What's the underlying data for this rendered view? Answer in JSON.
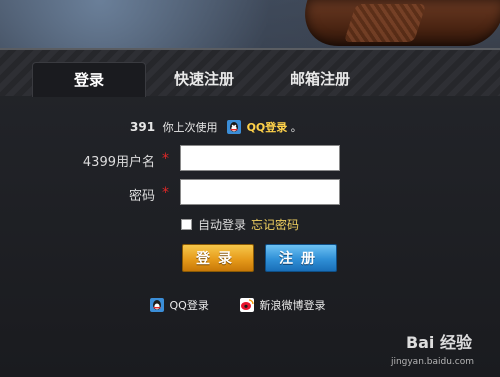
{
  "tabs": [
    {
      "label": "登录",
      "active": true
    },
    {
      "label": "快速注册",
      "active": false
    },
    {
      "label": "邮箱注册",
      "active": false
    }
  ],
  "hint": {
    "logo_text": "391",
    "prefix": "你上次使用",
    "method": "QQ登录",
    "suffix": "。"
  },
  "form": {
    "username_label": "4399用户名",
    "password_label": "密码",
    "required_mark": "*",
    "username_value": "",
    "password_value": "",
    "remember_label": "自动登录",
    "forgot_label": "忘记密码"
  },
  "buttons": {
    "login": "登录",
    "register": "注册"
  },
  "social": {
    "qq": "QQ登录",
    "weibo": "新浪微博登录"
  },
  "watermark": {
    "brand": "Bai 经验",
    "url": "jingyan.baidu.com"
  },
  "colors": {
    "accent_gold": "#f0b030",
    "accent_blue": "#2f8fd6",
    "required_red": "#e02828"
  }
}
